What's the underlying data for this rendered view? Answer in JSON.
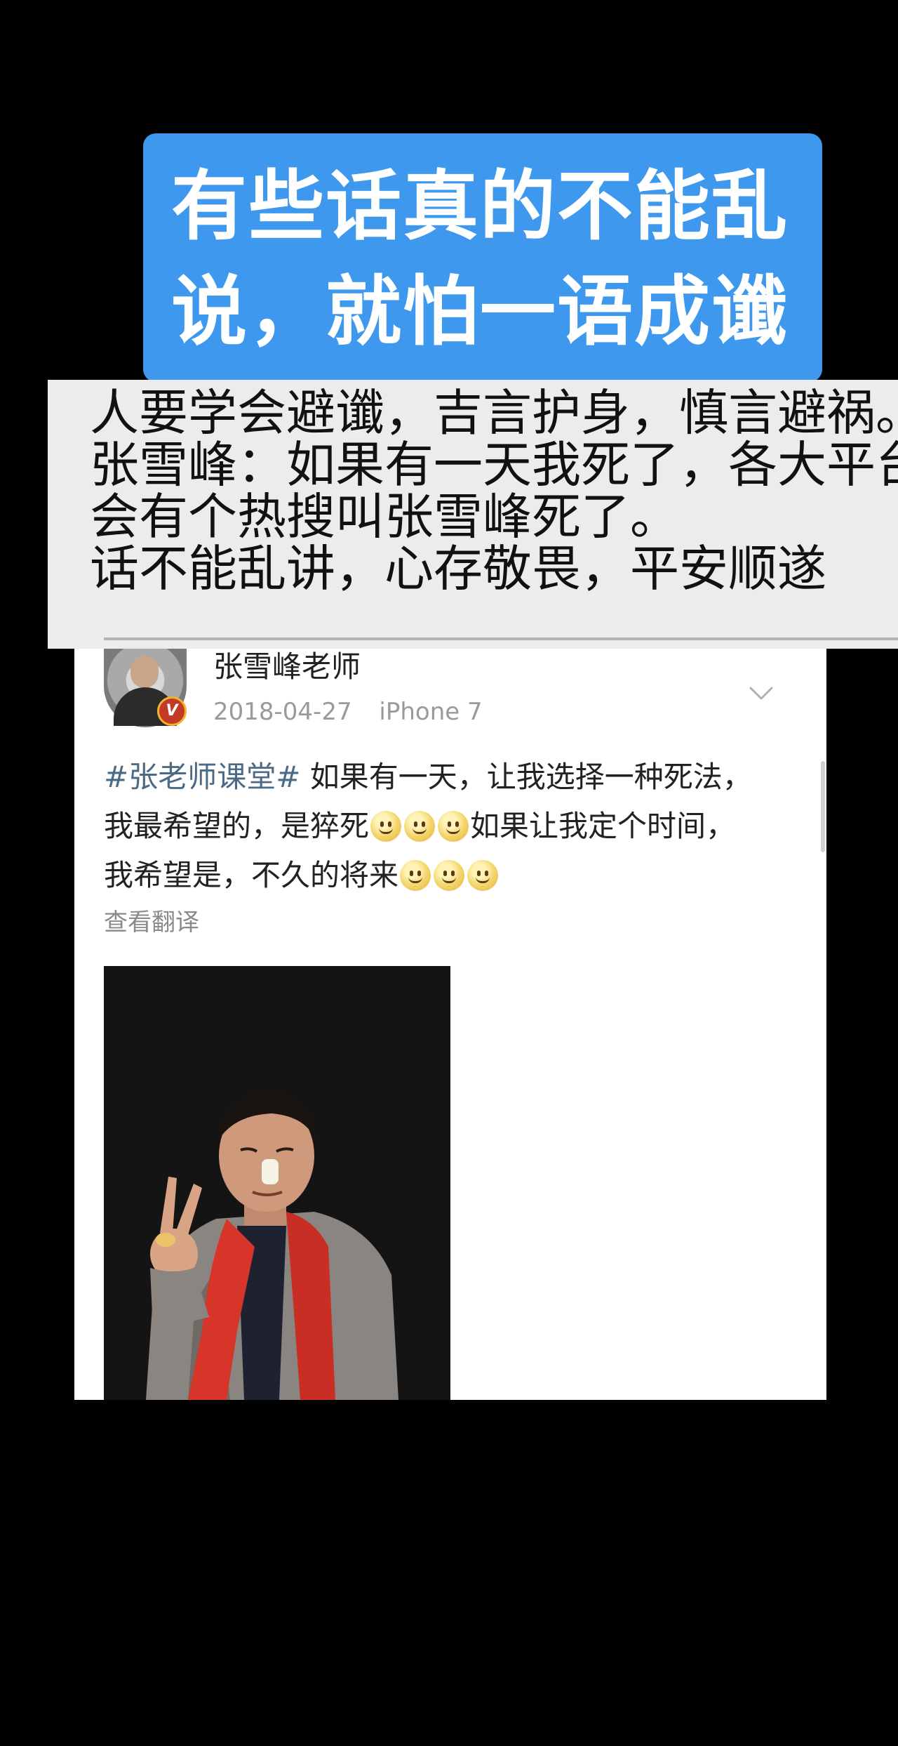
{
  "title": {
    "lines": [
      "有些话真的不能乱",
      "说，就怕一语成谶"
    ]
  },
  "caption": {
    "lines": [
      "人要学会避谶，吉言护身，慎言避祸。",
      "张雪峰：如果有一天我死了，各大平台",
      "会有个热搜叫张雪峰死了。",
      "话不能乱讲，心存敬畏，平安顺遂"
    ]
  },
  "post": {
    "author": "张雪峰老师",
    "verified_mark": "V",
    "date": "2018-04-27",
    "device": "iPhone 7",
    "hashtag": "#张老师课堂#",
    "text_line1_rest": " 如果有一天，让我选择一种死法，",
    "text_line2_a": "我最希望的，是猝死",
    "text_line2_b": "如果让我定个时间，",
    "text_line3": "我希望是，不久的将来",
    "translate_label": "查看翻译",
    "emoji_icon": "smile-emoji-icon",
    "menu_icon": "chevron-down-icon"
  },
  "colors": {
    "banner": "#3d98ee",
    "caption_bg": "#ececec",
    "hashtag": "#4b6a86",
    "scarf": "#d8352a"
  }
}
